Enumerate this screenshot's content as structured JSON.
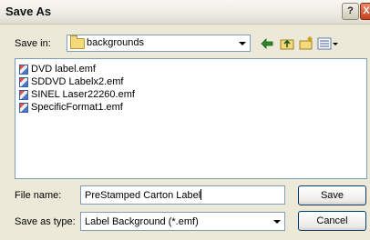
{
  "window": {
    "title": "Save As",
    "help_label": "?",
    "close_label": "X"
  },
  "save_in": {
    "label": "Save in:",
    "value": "backgrounds"
  },
  "toolbar": {
    "icons": [
      "back-icon",
      "up-folder-icon",
      "new-folder-icon",
      "views-menu-icon"
    ]
  },
  "files": [
    {
      "name": "DVD label.emf"
    },
    {
      "name": "SDDVD Labelx2.emf"
    },
    {
      "name": "SINEL Laser22260.emf"
    },
    {
      "name": "SpecificFormat1.emf"
    }
  ],
  "file_name": {
    "label": "File name:",
    "value": "PreStamped Carton Label"
  },
  "save_as_type": {
    "label": "Save as type:",
    "value": "Label Background (*.emf)"
  },
  "buttons": {
    "save": "Save",
    "cancel": "Cancel"
  }
}
